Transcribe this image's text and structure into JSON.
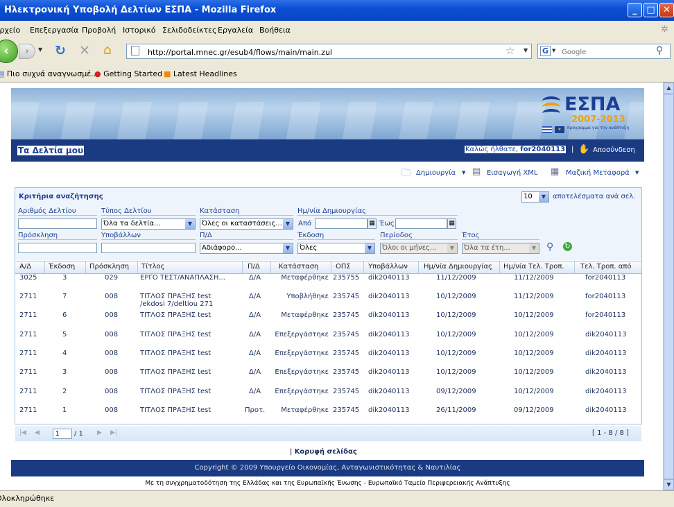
{
  "window": {
    "title": "Ηλεκτρονική Υποβολή Δελτίων ΕΣΠΑ - Mozilla Firefox"
  },
  "menu": [
    "Αρχείο",
    "Επεξεργασία",
    "Προβολή",
    "Ιστορικό",
    "Σελιδοδείκτες",
    "Εργαλεία",
    "Βοήθεια"
  ],
  "nav": {
    "url": "http://portal.mnec.gr/esub4/flows/main/main.zul",
    "search_placeholder": "Google",
    "search_engine_letter": "G"
  },
  "bookmarks": [
    "Πιο συχνά αναγνωσμέ...",
    "Getting Started",
    "Latest Headlines"
  ],
  "banner": {
    "logo": "ΕΣΠΑ",
    "years": "2007-2013",
    "tagline": "πρόγραμμα για την ανάπτυξη"
  },
  "header": {
    "my_reports": "Τα Δελτία μου",
    "welcome": "Καλώς ήλθατε,",
    "username": "for2040113",
    "separator": "|",
    "logout": "Αποσύνδεση"
  },
  "toolbar": {
    "create": "Δημιουργία",
    "import_xml": "Εισαγωγή XML",
    "bulk_transfer": "Μαζική Μεταφορά"
  },
  "search": {
    "title": "Κριτήρια αναζήτησης",
    "page_size": "10",
    "page_size_label": "αποτελέσματα ανά σελ.",
    "labels": {
      "report_number": "Αριθμός Δελτίου",
      "report_type": "Τύπος Δελτίου",
      "status": "Κατάσταση",
      "creation_date": "Ημ/νία Δημιουργίας",
      "from": "Από",
      "to": "Έως",
      "call": "Πρόσκληση",
      "submitter": "Υποβάλλων",
      "pd": "Π/Δ",
      "version": "Έκδοση",
      "period": "Περίοδος",
      "year": "Έτος"
    },
    "values": {
      "report_type": "Όλα τα δελτία...",
      "status": "Όλες οι καταστάσεις...",
      "pd": "Αδιάφορο...",
      "version": "Όλες",
      "period": "Όλοι οι μήνες...",
      "year": "Όλα τα έτη..."
    }
  },
  "grid": {
    "columns": [
      "Α/Δ",
      "Έκδοση",
      "Πρόσκληση",
      "Τίτλος",
      "Π/Δ",
      "Κατάσταση",
      "ΟΠΣ",
      "Υποβάλλων",
      "Ημ/νία Δημιουργίας",
      "Ημ/νία Τελ. Τροπ.",
      "Τελ. Τροπ. από"
    ],
    "rows": [
      {
        "ad": "3025",
        "ver": "3",
        "call": "029",
        "title": "ΕΡΓΟ ΤΕΣΤ/ΑΝΑΠΛΑΣΗ...",
        "title2": "",
        "pd": "Δ/Α",
        "status": "Μεταφέρθηκε",
        "ops": "235755",
        "sub": "dik2040113",
        "created": "11/12/2009",
        "modified": "11/12/2009",
        "by": "for2040113"
      },
      {
        "ad": "2711",
        "ver": "7",
        "call": "008",
        "title": "ΤΙΤΛΟΣ ΠΡΑΞΗΣ test",
        "title2": "/ekdosi 7/deltiou 271",
        "pd": "Δ/Α",
        "status": "Υποβλήθηκε",
        "ops": "235745",
        "sub": "dik2040113",
        "created": "10/12/2009",
        "modified": "11/12/2009",
        "by": "for2040113"
      },
      {
        "ad": "2711",
        "ver": "6",
        "call": "008",
        "title": "ΤΙΤΛΟΣ ΠΡΑΞΗΣ test",
        "title2": "",
        "pd": "Δ/Α",
        "status": "Μεταφέρθηκε",
        "ops": "235745",
        "sub": "dik2040113",
        "created": "10/12/2009",
        "modified": "10/12/2009",
        "by": "for2040113"
      },
      {
        "ad": "2711",
        "ver": "5",
        "call": "008",
        "title": "ΤΙΤΛΟΣ ΠΡΑΞΗΣ test",
        "title2": "",
        "pd": "Δ/Α",
        "status": "Επεξεργάστηκε",
        "ops": "235745",
        "sub": "dik2040113",
        "created": "10/12/2009",
        "modified": "10/12/2009",
        "by": "dik2040113"
      },
      {
        "ad": "2711",
        "ver": "4",
        "call": "008",
        "title": "ΤΙΤΛΟΣ ΠΡΑΞΗΣ test",
        "title2": "",
        "pd": "Δ/Α",
        "status": "Επεξεργάστηκε",
        "ops": "235745",
        "sub": "dik2040113",
        "created": "10/12/2009",
        "modified": "10/12/2009",
        "by": "dik2040113"
      },
      {
        "ad": "2711",
        "ver": "3",
        "call": "008",
        "title": "ΤΙΤΛΟΣ ΠΡΑΞΗΣ test",
        "title2": "",
        "pd": "Δ/Α",
        "status": "Επεξεργάστηκε",
        "ops": "235745",
        "sub": "dik2040113",
        "created": "10/12/2009",
        "modified": "10/12/2009",
        "by": "dik2040113"
      },
      {
        "ad": "2711",
        "ver": "2",
        "call": "008",
        "title": "ΤΙΤΛΟΣ ΠΡΑΞΗΣ test",
        "title2": "",
        "pd": "Δ/Α",
        "status": "Επεξεργάστηκε",
        "ops": "235745",
        "sub": "dik2040113",
        "created": "09/12/2009",
        "modified": "10/12/2009",
        "by": "dik2040113"
      },
      {
        "ad": "2711",
        "ver": "1",
        "call": "008",
        "title": "ΤΙΤΛΟΣ ΠΡΑΞΗΣ test",
        "title2": "",
        "pd": "Προτ.",
        "status": "Μεταφέρθηκε",
        "ops": "235745",
        "sub": "dik2040113",
        "created": "26/11/2009",
        "modified": "09/12/2009",
        "by": "dik2040113"
      }
    ]
  },
  "pager": {
    "page": "1",
    "total": "/ 1",
    "range": "[ 1 - 8 / 8 ]"
  },
  "footer": {
    "top_link_sep": "|",
    "top_link": "Κορυφή σελίδας",
    "copyright": "Copyright © 2009 Υπουργείο Οικονομίας, Ανταγωνιστικότητας & Ναυτιλίας",
    "cofunding": "Με τη συγχρηματοδότηση της Ελλάδας και της Ευρωπαϊκής Ένωσης - Ευρωπαϊκό Ταμείο Περιφερειακής Ανάπτυξης"
  },
  "status": {
    "text": "Ολοκληρώθηκε"
  }
}
